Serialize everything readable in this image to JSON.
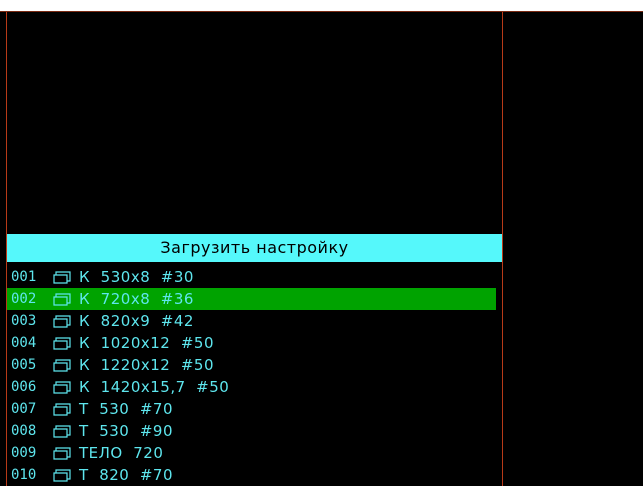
{
  "dialog": {
    "title": "Загрузить настройку"
  },
  "colors": {
    "title_bg": "#55f8fb",
    "row_text": "#5ee6ee",
    "selected_bg": "#00a300",
    "panel_border": "#b83a18",
    "background": "#000000"
  },
  "presets": [
    {
      "num": "001",
      "icon": "folder-icon",
      "name": "К  530x8  #30",
      "selected": false
    },
    {
      "num": "002",
      "icon": "folder-icon",
      "name": "К  720x8  #36",
      "selected": true
    },
    {
      "num": "003",
      "icon": "folder-icon",
      "name": "К  820x9  #42",
      "selected": false
    },
    {
      "num": "004",
      "icon": "folder-icon",
      "name": "К  1020x12  #50",
      "selected": false
    },
    {
      "num": "005",
      "icon": "folder-icon",
      "name": "К  1220x12  #50",
      "selected": false
    },
    {
      "num": "006",
      "icon": "folder-icon",
      "name": "К  1420x15,7  #50",
      "selected": false
    },
    {
      "num": "007",
      "icon": "folder-icon",
      "name": "Т  530  #70",
      "selected": false
    },
    {
      "num": "008",
      "icon": "folder-icon",
      "name": "Т  530  #90",
      "selected": false
    },
    {
      "num": "009",
      "icon": "folder-icon",
      "name": "ТЕЛО  720",
      "selected": false
    },
    {
      "num": "010",
      "icon": "folder-icon",
      "name": "Т  820  #70",
      "selected": false
    }
  ]
}
